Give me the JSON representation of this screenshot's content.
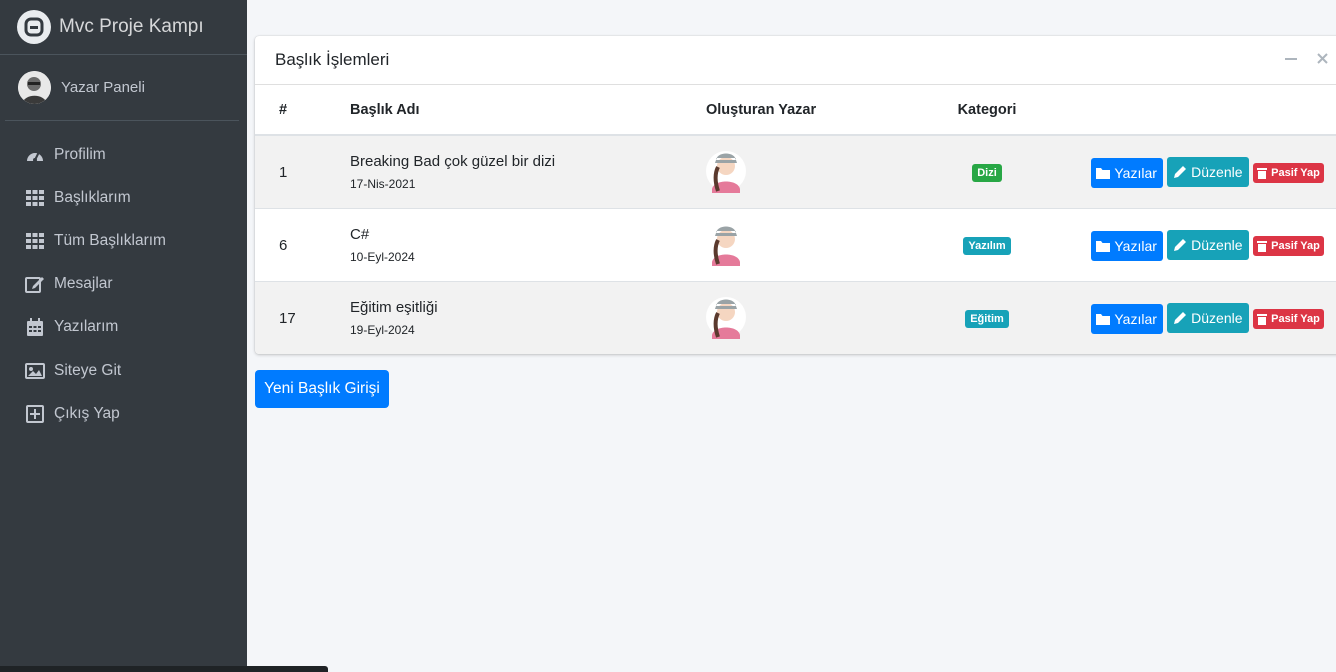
{
  "brand": {
    "title": "Mvc Proje Kampı"
  },
  "user": {
    "name": "Yazar Paneli"
  },
  "sidebar": {
    "items": [
      {
        "label": "Profilim",
        "icon": "tachometer-icon"
      },
      {
        "label": "Başlıklarım",
        "icon": "grid-icon"
      },
      {
        "label": "Tüm Başlıklarım",
        "icon": "grid-icon"
      },
      {
        "label": "Mesajlar",
        "icon": "edit-icon"
      },
      {
        "label": "Yazılarım",
        "icon": "calendar-icon"
      },
      {
        "label": "Siteye Git",
        "icon": "image-icon"
      },
      {
        "label": "Çıkış Yap",
        "icon": "plus-square-icon"
      }
    ]
  },
  "card": {
    "title": "Başlık İşlemleri",
    "columns": {
      "id": "#",
      "name": "Başlık Adı",
      "author": "Oluşturan Yazar",
      "category": "Kategori"
    },
    "rows": [
      {
        "id": "1",
        "name": "Breaking Bad çok güzel bir dizi",
        "date": "17-Nis-2021",
        "category": "Dizi",
        "category_color": "#28a745"
      },
      {
        "id": "6",
        "name": "C#",
        "date": "10-Eyl-2024",
        "category": "Yazılım",
        "category_color": "#17a2b8"
      },
      {
        "id": "17",
        "name": "Eğitim eşitliği",
        "date": "19-Eyl-2024",
        "category": "Eğitim",
        "category_color": "#17a2b8"
      }
    ],
    "buttons": {
      "posts": "Yazılar",
      "edit": "Düzenle",
      "deactivate": "Pasif Yap"
    }
  },
  "new_button": {
    "label": "Yeni Başlık Girişi"
  },
  "colors": {
    "sidebar": "#343a40",
    "primary": "#007bff",
    "info": "#17a2b8",
    "danger": "#dc3545",
    "success": "#28a745"
  }
}
